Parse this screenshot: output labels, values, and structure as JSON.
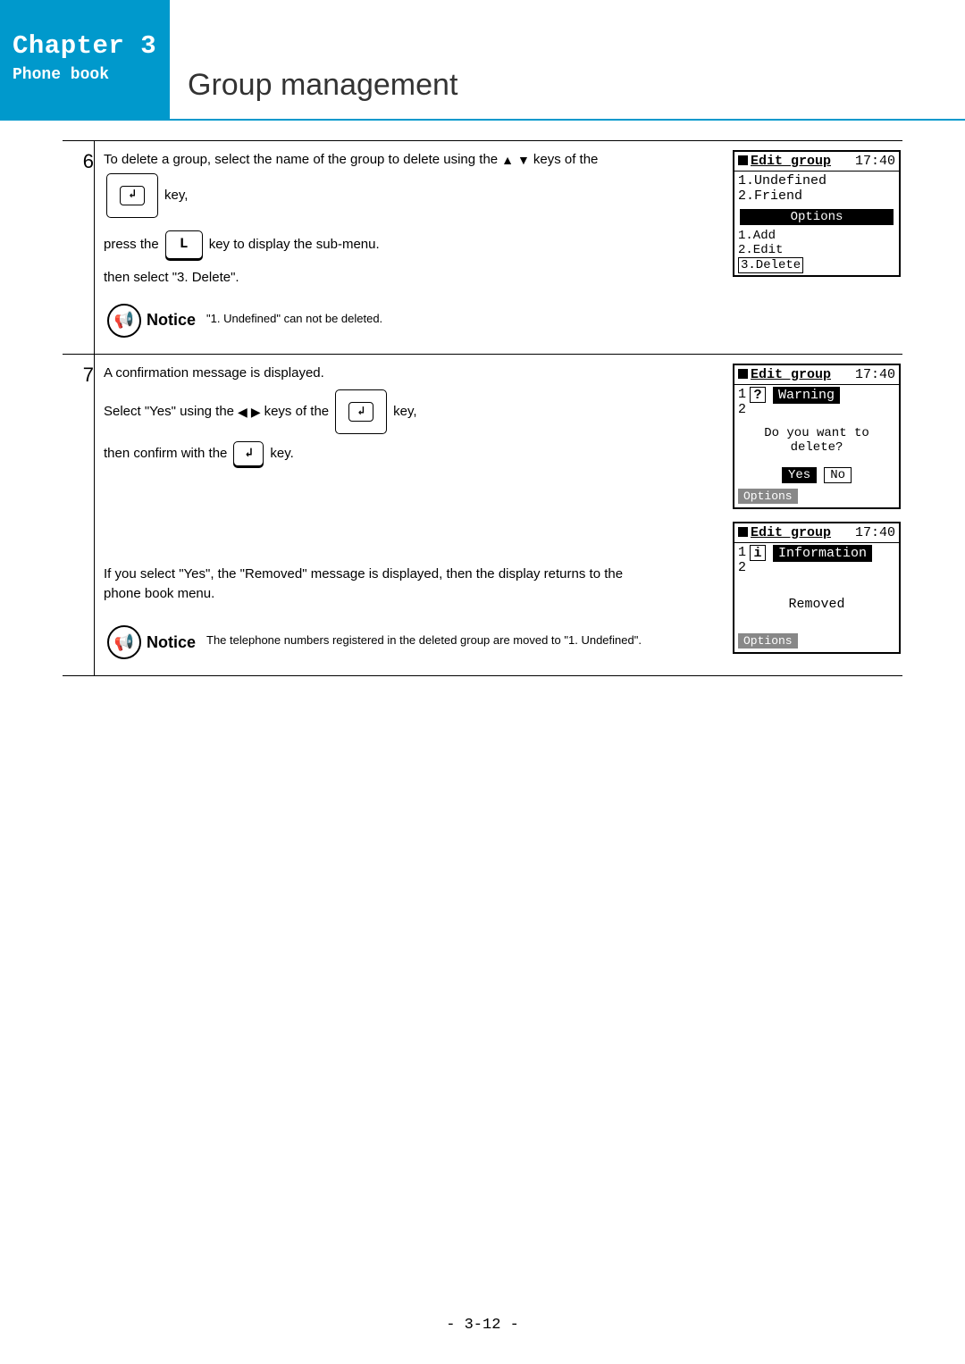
{
  "header": {
    "chapter": "Chapter 3",
    "subtitle": "Phone book",
    "section": "Group management"
  },
  "step6": {
    "num": "6",
    "line1_a": "To delete a group, select the name of the group to delete using the",
    "line1_b": "keys of the",
    "key_label": "key,",
    "line2_a": "press the",
    "l_key": "L",
    "line2_b": "key to display the sub-menu.",
    "line3": "then select \"3. Delete\".",
    "notice_label": "Notice",
    "notice_text": "\"1. Undefined\" can not be deleted.",
    "screen": {
      "title": "Edit group",
      "time": "17:40",
      "item1": "1.Undefined",
      "item2": "2.Friend",
      "options": "Options",
      "opt1": "1.Add",
      "opt2": "2.Edit",
      "opt3": "3.Delete"
    }
  },
  "step7": {
    "num": "7",
    "line1": "A confirmation message is displayed.",
    "line2_a": "Select \"Yes\" using the",
    "line2_b": "keys of the",
    "line2_c": "key,",
    "line3_a": "then confirm with the",
    "line3_b": "key.",
    "line_mid_a": "If you select \"Yes\", the \"Removed\" message is displayed, then the display returns to the",
    "line_mid_b": "phone book menu.",
    "notice_label": "Notice",
    "notice_text": "The telephone numbers registered in the deleted group are moved to \"1. Undefined\".",
    "screenA": {
      "title": "Edit group",
      "time": "17:40",
      "row1": "1",
      "row2": "2",
      "warning": "Warning",
      "msg1": "Do you want to",
      "msg2": "delete?",
      "yes": "Yes",
      "no": "No",
      "footer": "Options"
    },
    "screenB": {
      "title": "Edit group",
      "time": "17:40",
      "row1": "1",
      "row2": "2",
      "info": "Information",
      "msg": "Removed",
      "footer": "Options"
    }
  },
  "footer": {
    "page": "- 3-12 -"
  }
}
